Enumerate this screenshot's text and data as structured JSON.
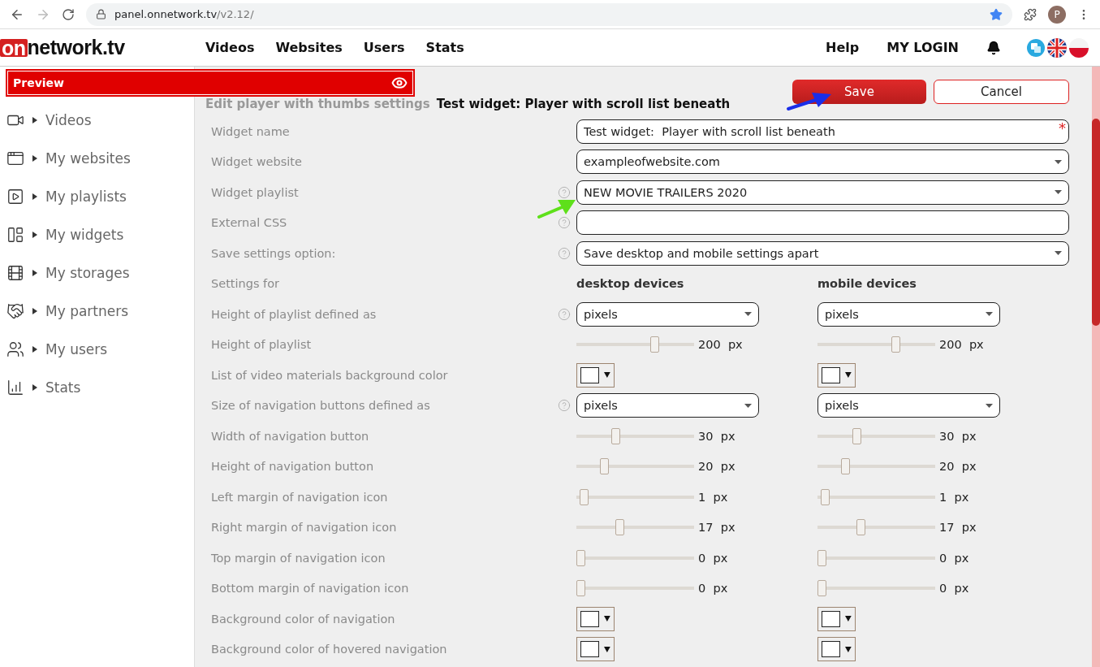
{
  "browser": {
    "url_host": "panel.onnetwork.tv",
    "url_path": "/v2.12/",
    "profile_initial": "P"
  },
  "header": {
    "logo_on": "on",
    "logo_rest": "network.tv",
    "nav": [
      "Videos",
      "Websites",
      "Users",
      "Stats"
    ],
    "help": "Help",
    "login": "MY LOGIN"
  },
  "preview": {
    "label": "Preview"
  },
  "sidebar": {
    "items": [
      {
        "kind": "camera",
        "label": "Videos"
      },
      {
        "kind": "website",
        "label": "My websites"
      },
      {
        "kind": "playlist",
        "label": "My playlists"
      },
      {
        "kind": "widget",
        "label": "My widgets"
      },
      {
        "kind": "reel",
        "label": "My storages"
      },
      {
        "kind": "handshake",
        "label": "My partners"
      },
      {
        "kind": "users",
        "label": "My users"
      },
      {
        "kind": "chart",
        "label": "Stats"
      }
    ]
  },
  "page": {
    "heading_gray": "Edit player with thumbs settings",
    "heading": "Test widget: Player with scroll list beneath",
    "save": "Save",
    "cancel": "Cancel"
  },
  "rows": [
    {
      "kind": "text",
      "label": "Widget name",
      "value": "Test widget:  Player with scroll list beneath",
      "help": false,
      "required_mark": "*"
    },
    {
      "kind": "select",
      "label": "Widget website",
      "value": "exampleofwebsite.com",
      "help": false
    },
    {
      "kind": "select",
      "label": "Widget playlist",
      "value": "NEW MOVIE TRAILERS 2020",
      "help": true
    },
    {
      "kind": "text",
      "label": "External CSS",
      "help": true
    },
    {
      "kind": "select",
      "label": "Save settings option:",
      "value": "Save desktop and mobile settings apart",
      "help": true
    },
    {
      "kind": "columns",
      "label": "Settings for",
      "desktop": "desktop devices",
      "mobile": "mobile devices"
    },
    {
      "kind": "dual_select",
      "label": "Height of playlist defined as",
      "help": true,
      "desktop": "pixels",
      "mobile": "pixels"
    },
    {
      "kind": "dual_slider",
      "label": "Height of playlist",
      "desktop": {
        "level": 0.68,
        "reading": "200",
        "unit": "px"
      },
      "mobile": {
        "level": 0.68,
        "reading": "200",
        "unit": "px"
      }
    },
    {
      "kind": "dual_color",
      "label": "List of video materials background color"
    },
    {
      "kind": "dual_select",
      "label": "Size of navigation buttons defined as",
      "help": true,
      "desktop": "pixels",
      "mobile": "pixels"
    },
    {
      "kind": "dual_slider",
      "label": "Width of navigation button",
      "desktop": {
        "level": 0.32,
        "reading": "30",
        "unit": "px"
      },
      "mobile": {
        "level": 0.32,
        "reading": "30",
        "unit": "px"
      }
    },
    {
      "kind": "dual_slider",
      "label": "Height of navigation button",
      "desktop": {
        "level": 0.22,
        "reading": "20",
        "unit": "px"
      },
      "mobile": {
        "level": 0.22,
        "reading": "20",
        "unit": "px"
      }
    },
    {
      "kind": "dual_slider",
      "label": "Left margin of navigation icon",
      "desktop": {
        "level": 0.03,
        "reading": "1",
        "unit": "px"
      },
      "mobile": {
        "level": 0.03,
        "reading": "1",
        "unit": "px"
      }
    },
    {
      "kind": "dual_slider",
      "label": "Right margin of navigation icon",
      "desktop": {
        "level": 0.36,
        "reading": "17",
        "unit": "px"
      },
      "mobile": {
        "level": 0.36,
        "reading": "17",
        "unit": "px"
      }
    },
    {
      "kind": "dual_slider",
      "label": "Top margin of navigation icon",
      "desktop": {
        "level": 0,
        "reading": "0",
        "unit": "px"
      },
      "mobile": {
        "level": 0,
        "reading": "0",
        "unit": "px"
      }
    },
    {
      "kind": "dual_slider",
      "label": "Bottom margin of navigation icon",
      "desktop": {
        "level": 0,
        "reading": "0",
        "unit": "px"
      },
      "mobile": {
        "level": 0,
        "reading": "0",
        "unit": "px"
      }
    },
    {
      "kind": "dual_color",
      "label": "Background color of navigation"
    },
    {
      "kind": "dual_color",
      "label": "Background color of hovered navigation"
    }
  ]
}
